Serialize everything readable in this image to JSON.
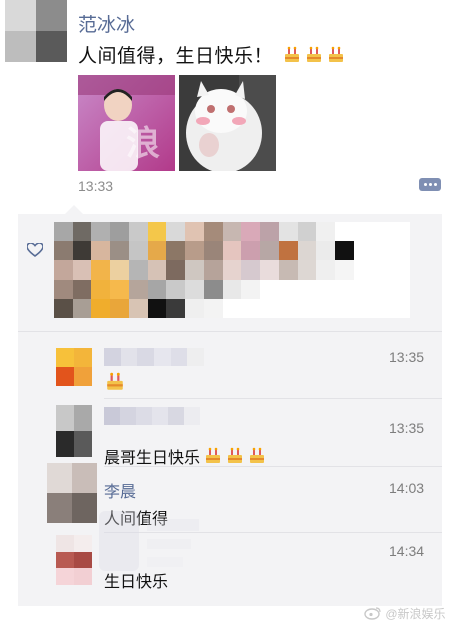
{
  "post": {
    "author": "范冰冰",
    "text": "人间值得，生日快乐！",
    "time": "13:33"
  },
  "comments": [
    {
      "time": "13:35",
      "text": ""
    },
    {
      "time": "13:35",
      "text": "晨哥生日快乐"
    },
    {
      "name": "李晨",
      "time": "14:03",
      "text": "人间值得"
    },
    {
      "time": "14:34",
      "text": "生日快乐"
    }
  ],
  "watermark": "@新浪娱乐",
  "colors": {
    "link": "#576b95",
    "comment_bg": "#f3f3f5",
    "more_button": "#7f8fb3"
  }
}
